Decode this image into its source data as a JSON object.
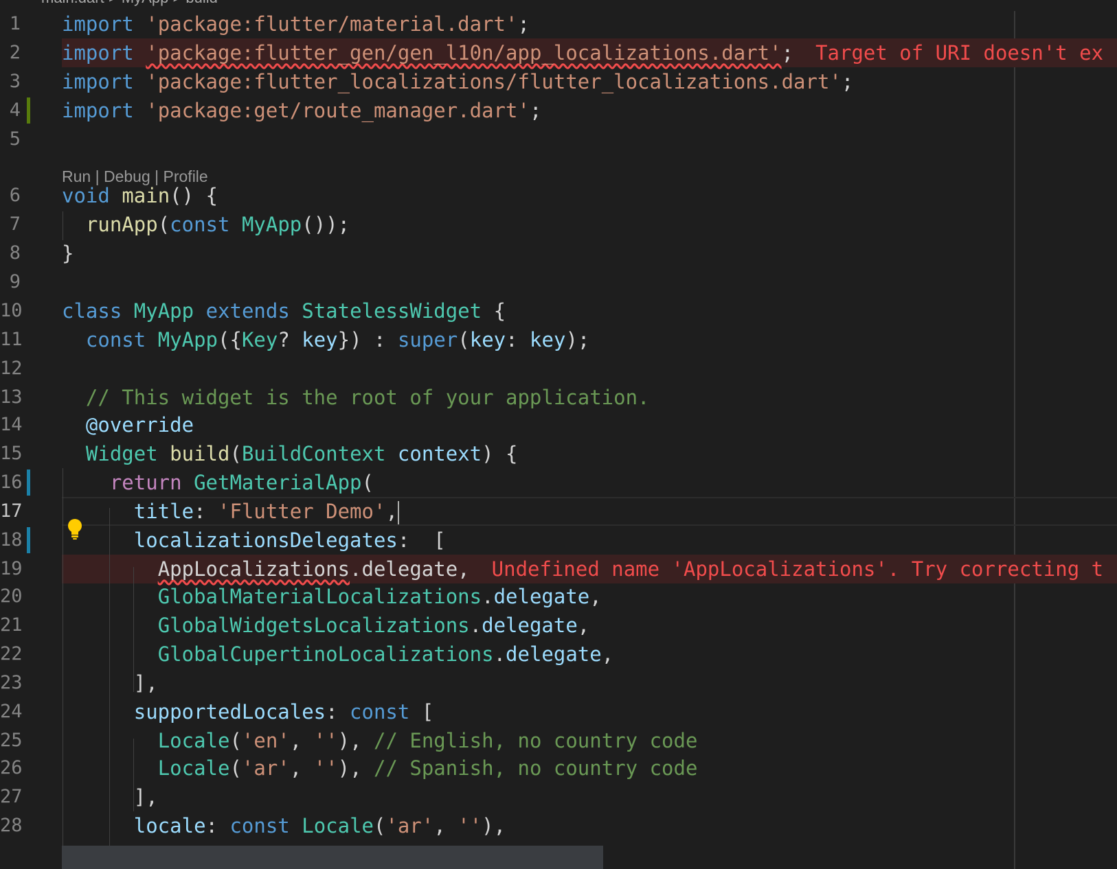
{
  "breadcrumb": {
    "file": "main.dart",
    "separator": ">",
    "class": "MyApp",
    "method": "build"
  },
  "codelens": {
    "run": "Run",
    "debug": "Debug",
    "profile": "Profile",
    "separator": "|"
  },
  "active_line": 17,
  "lines": [
    {
      "n": "1",
      "tokens": [
        {
          "t": "import",
          "c": "kw"
        },
        {
          "t": " "
        },
        {
          "t": "'package:flutter/material.dart'",
          "c": "str"
        },
        {
          "t": ";"
        }
      ]
    },
    {
      "n": "2",
      "tokens": [
        {
          "t": "import",
          "c": "kw"
        },
        {
          "t": " "
        },
        {
          "t": "'package:flutter_gen/gen_l10n/app_localizations.dart'",
          "c": "str squig"
        },
        {
          "t": ";"
        }
      ],
      "diagnostic": "Target of URI doesn't ex",
      "error": true
    },
    {
      "n": "3",
      "tokens": [
        {
          "t": "import",
          "c": "kw"
        },
        {
          "t": " "
        },
        {
          "t": "'package:flutter_localizations/flutter_localizations.dart'",
          "c": "str"
        },
        {
          "t": ";"
        }
      ]
    },
    {
      "n": "4",
      "tokens": [
        {
          "t": "import",
          "c": "kw"
        },
        {
          "t": " "
        },
        {
          "t": "'package:get/route_manager.dart'",
          "c": "str"
        },
        {
          "t": ";"
        }
      ],
      "gutter": "green"
    },
    {
      "n": "5",
      "tokens": []
    },
    {
      "n": "6",
      "tokens": [
        {
          "t": "void",
          "c": "kw"
        },
        {
          "t": " "
        },
        {
          "t": "main",
          "c": "fn"
        },
        {
          "t": "() {"
        }
      ]
    },
    {
      "n": "7",
      "tokens": [
        {
          "t": "  "
        },
        {
          "t": "runApp",
          "c": "fn"
        },
        {
          "t": "("
        },
        {
          "t": "const",
          "c": "kw"
        },
        {
          "t": " "
        },
        {
          "t": "MyApp",
          "c": "type"
        },
        {
          "t": "());"
        }
      ]
    },
    {
      "n": "8",
      "tokens": [
        {
          "t": "}"
        }
      ]
    },
    {
      "n": "9",
      "tokens": []
    },
    {
      "n": "10",
      "tokens": [
        {
          "t": "class",
          "c": "kw"
        },
        {
          "t": " "
        },
        {
          "t": "MyApp",
          "c": "type"
        },
        {
          "t": " "
        },
        {
          "t": "extends",
          "c": "kw"
        },
        {
          "t": " "
        },
        {
          "t": "StatelessWidget",
          "c": "type"
        },
        {
          "t": " {"
        }
      ]
    },
    {
      "n": "11",
      "tokens": [
        {
          "t": "  "
        },
        {
          "t": "const",
          "c": "kw"
        },
        {
          "t": " "
        },
        {
          "t": "MyApp",
          "c": "type"
        },
        {
          "t": "({"
        },
        {
          "t": "Key",
          "c": "type"
        },
        {
          "t": "? "
        },
        {
          "t": "key",
          "c": "var"
        },
        {
          "t": "}) : "
        },
        {
          "t": "super",
          "c": "kw"
        },
        {
          "t": "("
        },
        {
          "t": "key",
          "c": "var"
        },
        {
          "t": ": "
        },
        {
          "t": "key",
          "c": "var"
        },
        {
          "t": ");"
        }
      ]
    },
    {
      "n": "12",
      "tokens": []
    },
    {
      "n": "13",
      "tokens": [
        {
          "t": "  "
        },
        {
          "t": "// This widget is the root of your application.",
          "c": "cm"
        }
      ]
    },
    {
      "n": "14",
      "tokens": [
        {
          "t": "  "
        },
        {
          "t": "@override",
          "c": "var"
        }
      ]
    },
    {
      "n": "15",
      "tokens": [
        {
          "t": "  "
        },
        {
          "t": "Widget",
          "c": "type"
        },
        {
          "t": " "
        },
        {
          "t": "build",
          "c": "fn"
        },
        {
          "t": "("
        },
        {
          "t": "BuildContext",
          "c": "type"
        },
        {
          "t": " "
        },
        {
          "t": "context",
          "c": "var"
        },
        {
          "t": ") {"
        }
      ]
    },
    {
      "n": "16",
      "tokens": [
        {
          "t": "    "
        },
        {
          "t": "return",
          "c": "ctl"
        },
        {
          "t": " "
        },
        {
          "t": "GetMaterialApp",
          "c": "type"
        },
        {
          "t": "("
        }
      ],
      "gutter": "blue"
    },
    {
      "n": "17",
      "tokens": [
        {
          "t": "      "
        },
        {
          "t": "title",
          "c": "var"
        },
        {
          "t": ": "
        },
        {
          "t": "'Flutter Demo'",
          "c": "str"
        },
        {
          "t": ","
        }
      ],
      "cursor": true
    },
    {
      "n": "18",
      "tokens": [
        {
          "t": "      "
        },
        {
          "t": "localizationsDelegates",
          "c": "var"
        },
        {
          "t": ":  ["
        }
      ],
      "gutter": "blue"
    },
    {
      "n": "19",
      "tokens": [
        {
          "t": "        "
        },
        {
          "t": "AppLocalizations",
          "c": "squig"
        },
        {
          "t": ".delegate,"
        }
      ],
      "diagnostic": "Undefined name 'AppLocalizations'. Try correcting t",
      "error": true
    },
    {
      "n": "20",
      "tokens": [
        {
          "t": "        "
        },
        {
          "t": "GlobalMaterialLocalizations",
          "c": "type"
        },
        {
          "t": "."
        },
        {
          "t": "delegate",
          "c": "var"
        },
        {
          "t": ","
        }
      ]
    },
    {
      "n": "21",
      "tokens": [
        {
          "t": "        "
        },
        {
          "t": "GlobalWidgetsLocalizations",
          "c": "type"
        },
        {
          "t": "."
        },
        {
          "t": "delegate",
          "c": "var"
        },
        {
          "t": ","
        }
      ]
    },
    {
      "n": "22",
      "tokens": [
        {
          "t": "        "
        },
        {
          "t": "GlobalCupertinoLocalizations",
          "c": "type"
        },
        {
          "t": "."
        },
        {
          "t": "delegate",
          "c": "var"
        },
        {
          "t": ","
        }
      ]
    },
    {
      "n": "23",
      "tokens": [
        {
          "t": "      ],"
        }
      ]
    },
    {
      "n": "24",
      "tokens": [
        {
          "t": "      "
        },
        {
          "t": "supportedLocales",
          "c": "var"
        },
        {
          "t": ": "
        },
        {
          "t": "const",
          "c": "kw"
        },
        {
          "t": " ["
        }
      ]
    },
    {
      "n": "25",
      "tokens": [
        {
          "t": "        "
        },
        {
          "t": "Locale",
          "c": "type"
        },
        {
          "t": "("
        },
        {
          "t": "'en'",
          "c": "str"
        },
        {
          "t": ", "
        },
        {
          "t": "''",
          "c": "str"
        },
        {
          "t": "), "
        },
        {
          "t": "// English, no country code",
          "c": "cm"
        }
      ]
    },
    {
      "n": "26",
      "tokens": [
        {
          "t": "        "
        },
        {
          "t": "Locale",
          "c": "type"
        },
        {
          "t": "("
        },
        {
          "t": "'ar'",
          "c": "str"
        },
        {
          "t": ", "
        },
        {
          "t": "''",
          "c": "str"
        },
        {
          "t": "), "
        },
        {
          "t": "// Spanish, no country code",
          "c": "cm"
        }
      ]
    },
    {
      "n": "27",
      "tokens": [
        {
          "t": "      ],"
        }
      ]
    },
    {
      "n": "28",
      "tokens": [
        {
          "t": "      "
        },
        {
          "t": "locale",
          "c": "var"
        },
        {
          "t": ": "
        },
        {
          "t": "const",
          "c": "kw"
        },
        {
          "t": " "
        },
        {
          "t": "Locale",
          "c": "type"
        },
        {
          "t": "("
        },
        {
          "t": "'ar'",
          "c": "str"
        },
        {
          "t": ", "
        },
        {
          "t": "''",
          "c": "str"
        },
        {
          "t": "),"
        }
      ]
    }
  ]
}
